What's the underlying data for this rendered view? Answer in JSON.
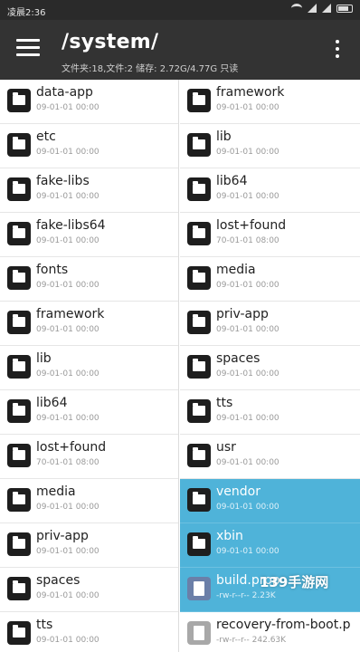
{
  "status_bar": {
    "time": "凌晨2:36"
  },
  "app_bar": {
    "title": "/system/",
    "subtitle": "文件夹:18,文件:2  储存: 2.72G/4.77G 只读"
  },
  "left_pane": {
    "items": [
      {
        "name": "data-app",
        "date": "09-01-01 00:00",
        "kind": "folder"
      },
      {
        "name": "etc",
        "date": "09-01-01 00:00",
        "kind": "folder"
      },
      {
        "name": "fake-libs",
        "date": "09-01-01 00:00",
        "kind": "folder"
      },
      {
        "name": "fake-libs64",
        "date": "09-01-01 00:00",
        "kind": "folder"
      },
      {
        "name": "fonts",
        "date": "09-01-01 00:00",
        "kind": "folder"
      },
      {
        "name": "framework",
        "date": "09-01-01 00:00",
        "kind": "folder"
      },
      {
        "name": "lib",
        "date": "09-01-01 00:00",
        "kind": "folder"
      },
      {
        "name": "lib64",
        "date": "09-01-01 00:00",
        "kind": "folder"
      },
      {
        "name": "lost+found",
        "date": "70-01-01 08:00",
        "kind": "folder"
      },
      {
        "name": "media",
        "date": "09-01-01 00:00",
        "kind": "folder"
      },
      {
        "name": "priv-app",
        "date": "09-01-01 00:00",
        "kind": "folder"
      },
      {
        "name": "spaces",
        "date": "09-01-01 00:00",
        "kind": "folder"
      },
      {
        "name": "tts",
        "date": "09-01-01 00:00",
        "kind": "folder"
      }
    ]
  },
  "right_pane": {
    "items": [
      {
        "name": "framework",
        "date": "09-01-01 00:00",
        "kind": "folder"
      },
      {
        "name": "lib",
        "date": "09-01-01 00:00",
        "kind": "folder"
      },
      {
        "name": "lib64",
        "date": "09-01-01 00:00",
        "kind": "folder"
      },
      {
        "name": "lost+found",
        "date": "70-01-01 08:00",
        "kind": "folder"
      },
      {
        "name": "media",
        "date": "09-01-01 00:00",
        "kind": "folder"
      },
      {
        "name": "priv-app",
        "date": "09-01-01 00:00",
        "kind": "folder"
      },
      {
        "name": "spaces",
        "date": "09-01-01 00:00",
        "kind": "folder"
      },
      {
        "name": "tts",
        "date": "09-01-01 00:00",
        "kind": "folder"
      },
      {
        "name": "usr",
        "date": "09-01-01 00:00",
        "kind": "folder"
      },
      {
        "name": "vendor",
        "date": "09-01-01 00:00",
        "kind": "folder",
        "selected": true
      },
      {
        "name": "xbin",
        "date": "09-01-01 00:00",
        "kind": "folder",
        "selected": true
      },
      {
        "name": "build.prop",
        "date": "-rw-r--r--  2.23K",
        "kind": "file",
        "selected": true
      },
      {
        "name": "recovery-from-boot.p",
        "date": "-rw-r--r--  242.63K",
        "kind": "file"
      }
    ]
  },
  "watermark": "139手游网"
}
